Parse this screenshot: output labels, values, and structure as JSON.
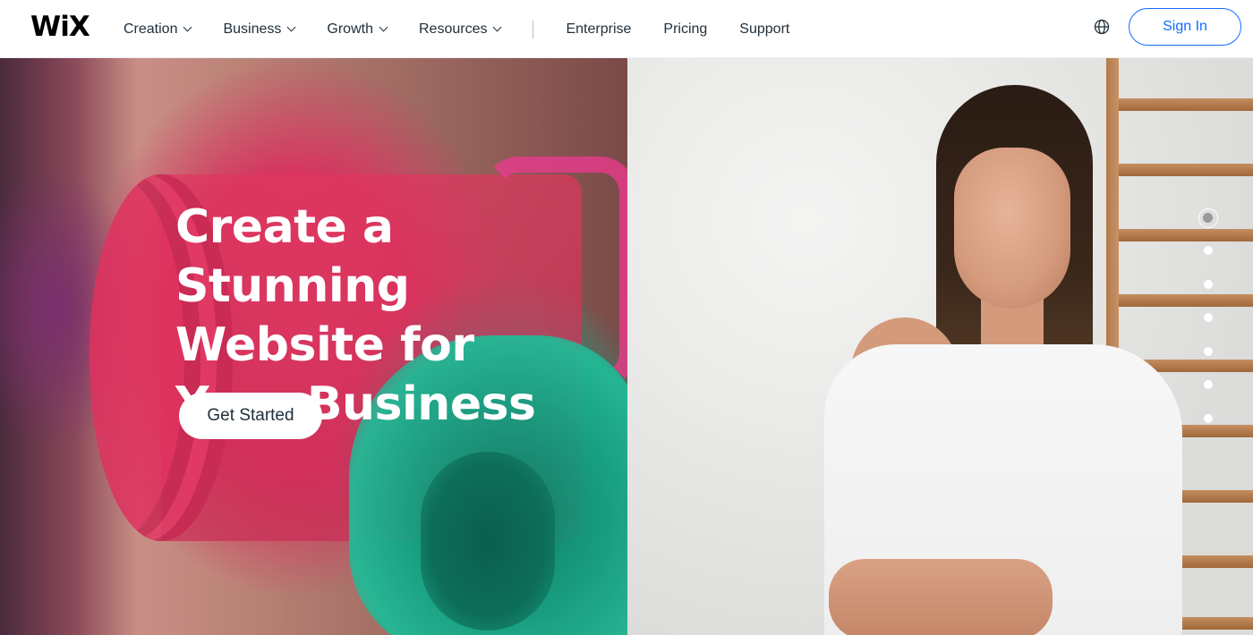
{
  "brand": {
    "logo_text": "WiX",
    "accent": "#116dff"
  },
  "nav": {
    "dropdown_items": [
      {
        "label": "Creation"
      },
      {
        "label": "Business"
      },
      {
        "label": "Growth"
      },
      {
        "label": "Resources"
      }
    ],
    "links": [
      {
        "label": "Enterprise"
      },
      {
        "label": "Pricing"
      },
      {
        "label": "Support"
      }
    ],
    "language_icon": "globe-icon",
    "sign_in_label": "Sign In"
  },
  "hero": {
    "headline_line1": "Create a Stunning",
    "headline_line2": "Website for",
    "headline_line3": "Your Business",
    "cta_label": "Get Started",
    "slides": {
      "count": 7,
      "active_index": 0
    }
  }
}
